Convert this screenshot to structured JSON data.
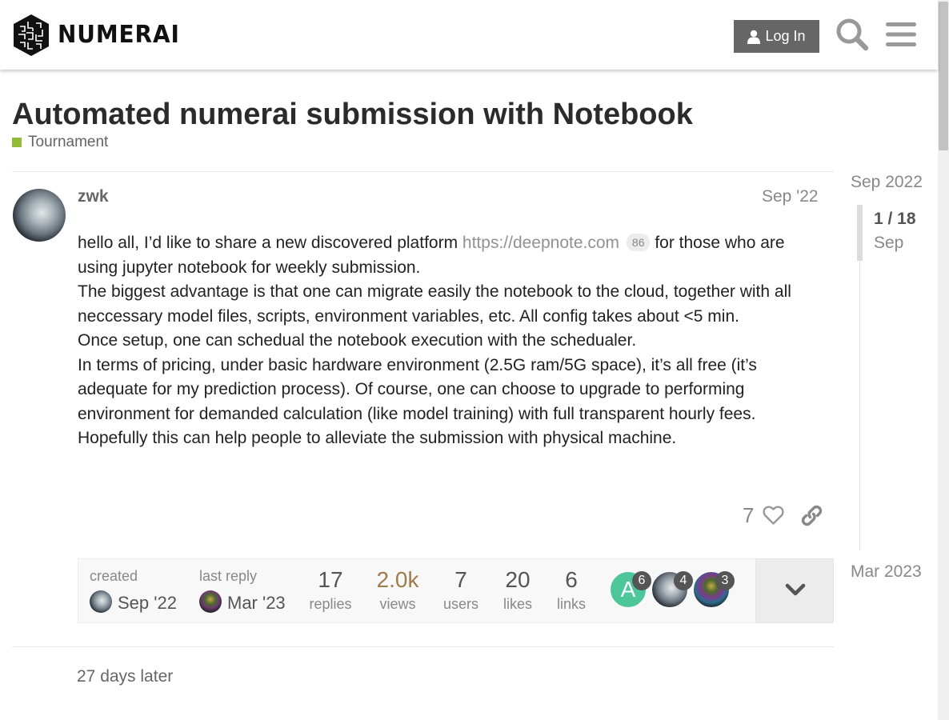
{
  "header": {
    "logo_text": "NUMERAI",
    "login_label": "Log In",
    "icons": {
      "logo": "numerai-logo-icon",
      "user": "user-icon",
      "search": "search-icon",
      "menu": "hamburger-menu-icon"
    }
  },
  "topic": {
    "title": "Automated numerai submission with Notebook",
    "category": "Tournament",
    "category_color": "#92ba37"
  },
  "post": {
    "username": "zwk",
    "date": "Sep '22",
    "intro_before_link": "hello all, I’d like to share a new discovered platform ",
    "link_text": "https://deepnote.com",
    "link_clicks": "86",
    "intro_after_link": " for those who are using jupyter notebook for weekly submission.",
    "paragraphs": [
      "The biggest advantage is that one can migrate easily the notebook to the cloud, together with all neccessary model files, scripts, environment variables, etc. All config takes about <5 min.",
      "Once setup, one can schedual the notebook execution with the schedualer.",
      "In terms of pricing, under basic hardware environment (2.5G ram/5G space), it’s all free (it’s adequate for my prediction process). Of course, one can choose to upgrade to performing environment for demanded calculation (like model training) with full transparent hourly fees.",
      "Hopefully this can help people to alleviate the submission with physical machine."
    ],
    "likes": "7",
    "icons": {
      "like": "heart-icon",
      "share": "link-icon"
    }
  },
  "topic_map": {
    "created_label": "created",
    "created_date": "Sep '22",
    "last_reply_label": "last reply",
    "last_reply_date": "Mar '23",
    "stats": [
      {
        "value": "17",
        "label": "replies"
      },
      {
        "value": "2.0k",
        "label": "views"
      },
      {
        "value": "7",
        "label": "users"
      },
      {
        "value": "20",
        "label": "likes"
      },
      {
        "value": "6",
        "label": "links"
      }
    ],
    "participants": [
      {
        "initial": "A",
        "count": "6",
        "color": "#4dc79a"
      },
      {
        "initial": "",
        "count": "4",
        "color": "#1d2229"
      },
      {
        "initial": "",
        "count": "3",
        "color": "#2a2f33"
      }
    ],
    "expand_icon": "chevron-down-icon"
  },
  "time_gap": "27 days later",
  "timeline": {
    "start": "Sep 2022",
    "progress": "1 / 18",
    "current": "Sep",
    "end": "Mar 2023"
  }
}
